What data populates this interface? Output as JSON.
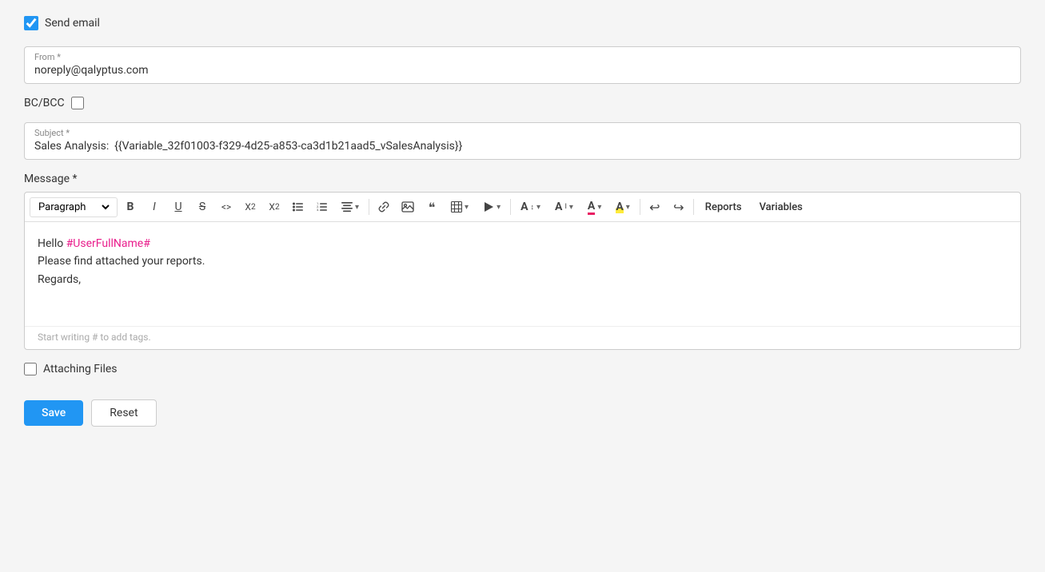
{
  "send_email": {
    "checkbox_checked": true,
    "label": "Send email"
  },
  "from_field": {
    "label": "From",
    "required": "*",
    "value": "noreply@qalyptus.com"
  },
  "bc_bcc": {
    "label": "BC/BCC",
    "checkbox_checked": false
  },
  "subject_field": {
    "label": "Subject",
    "required": "*",
    "value": "Sales Analysis:  {{Variable_32f01003-f329-4d25-a853-ca3d1b21aad5_vSalesAnalysis}}"
  },
  "message": {
    "label": "Message",
    "required": "*",
    "hint": "Start writing # to add tags.",
    "content_line1": "Hello ",
    "user_tag": "#UserFullName#",
    "content_line2": "Please find attached your reports.",
    "content_line3": "Regards,"
  },
  "toolbar": {
    "paragraph_label": "Paragraph",
    "bold_label": "B",
    "italic_label": "I",
    "underline_label": "U",
    "strikethrough_label": "S",
    "code_label": "<>",
    "subscript_label": "X₂",
    "superscript_label": "X²",
    "bullet_list_label": "≡",
    "ordered_list_label": "≡",
    "align_label": "≡",
    "link_label": "🔗",
    "image_label": "🖼",
    "blockquote_label": "❝",
    "table_label": "⊞",
    "media_label": "▶",
    "font_size_label": "A↕",
    "font_family_label": "A↔",
    "font_color_label": "A",
    "bg_color_label": "A",
    "undo_label": "↩",
    "redo_label": "↪",
    "reports_label": "Reports",
    "variables_label": "Variables"
  },
  "attaching_files": {
    "checkbox_checked": false,
    "label": "Attaching Files"
  },
  "actions": {
    "save_label": "Save",
    "reset_label": "Reset"
  },
  "colors": {
    "accent_blue": "#2196F3",
    "user_tag_pink": "#e91e8c",
    "border": "#ccc",
    "toolbar_border": "#ddd"
  }
}
